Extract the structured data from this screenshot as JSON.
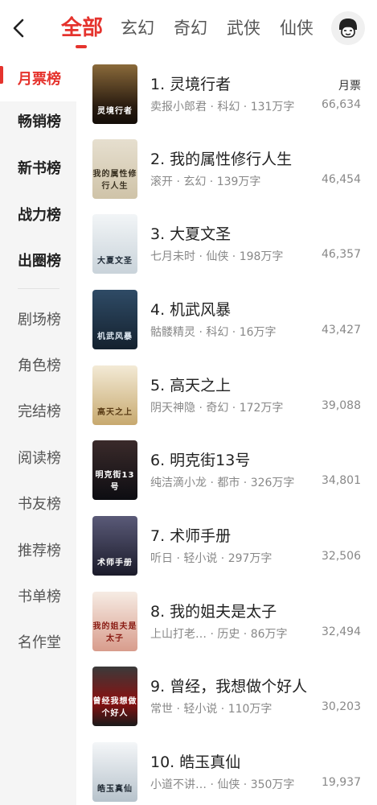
{
  "header": {
    "tabs": [
      "全部",
      "玄幻",
      "奇幻",
      "武侠",
      "仙侠"
    ]
  },
  "sidebar": {
    "items": [
      "月票榜",
      "畅销榜",
      "新书榜",
      "战力榜",
      "出圈榜",
      "剧场榜",
      "角色榜",
      "完结榜",
      "阅读榜",
      "书友榜",
      "推荐榜",
      "书单榜",
      "名作堂"
    ]
  },
  "list": {
    "metric_label": "月票",
    "books": [
      {
        "rank_title": "1. 灵境行者",
        "meta": "卖报小郎君 · 科幻 · 131万字",
        "count": "66,634",
        "cover_text": "灵境行者",
        "cover_color": "#3b2a1c"
      },
      {
        "rank_title": "2. 我的属性修行人生",
        "meta": "滚开 · 玄幻 · 139万字",
        "count": "46,454",
        "cover_text": "我的属性修行人生",
        "cover_color": "#d8cfbd"
      },
      {
        "rank_title": "3. 大夏文圣",
        "meta": "七月未时 · 仙侠 · 198万字",
        "count": "46,357",
        "cover_text": "大夏文圣",
        "cover_color": "#dfe6ea"
      },
      {
        "rank_title": "4. 机武风暴",
        "meta": "骷髅精灵 · 科幻 · 16万字",
        "count": "43,427",
        "cover_text": "机武风暴",
        "cover_color": "#1f3346"
      },
      {
        "rank_title": "5. 高天之上",
        "meta": "阴天神隐 · 奇幻 · 172万字",
        "count": "39,088",
        "cover_text": "高天之上",
        "cover_color": "#e9dfc7"
      },
      {
        "rank_title": "6. 明克街13号",
        "meta": "纯洁滴小龙 · 都市 · 326万字",
        "count": "34,801",
        "cover_text": "明克街13号",
        "cover_color": "#1d1d24"
      },
      {
        "rank_title": "7. 术师手册",
        "meta": "听日 · 轻小说 · 297万字",
        "count": "32,506",
        "cover_text": "术师手册",
        "cover_color": "#3a3a52"
      },
      {
        "rank_title": "8. 我的姐夫是太子",
        "meta": "上山打老… · 历史 · 86万字",
        "count": "32,494",
        "cover_text": "我的姐夫是太子",
        "cover_color": "#f1e6dc"
      },
      {
        "rank_title": "9. 曾经，我想做个好人",
        "meta": "常世 · 轻小说 · 110万字",
        "count": "30,203",
        "cover_text": "曾经我想做个好人",
        "cover_color": "#2a2a2a"
      },
      {
        "rank_title": "10. 皓玉真仙",
        "meta": "小道不讲… · 仙侠 · 350万字",
        "count": "19,937",
        "cover_text": "皓玉真仙",
        "cover_color": "#e7ecf0"
      }
    ]
  },
  "colors": {
    "accent": "#e5332d",
    "sidebar_bg": "#f5f5f5",
    "muted_text": "#888888"
  }
}
